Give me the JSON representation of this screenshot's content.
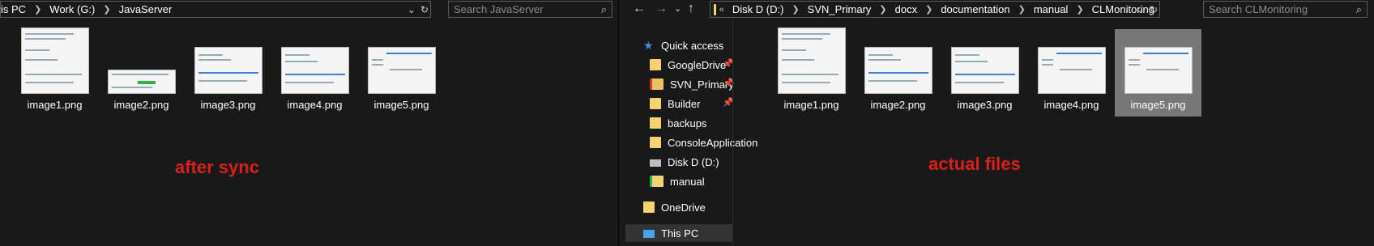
{
  "left": {
    "breadcrumb": [
      "is PC",
      "Work (G:)",
      "JavaServer"
    ],
    "search_placeholder": "Search JavaServer",
    "files": [
      "image1.png",
      "image2.png",
      "image3.png",
      "image4.png",
      "image5.png"
    ],
    "annotation": "after sync",
    "annotation_color": "#d9201a"
  },
  "right": {
    "breadcrumb": [
      "Disk D (D:)",
      "SVN_Primary",
      "docx",
      "documentation",
      "manual",
      "CLMonitoring"
    ],
    "search_placeholder": "Search CLMonitoring",
    "nav": {
      "quick_access": "Quick access",
      "items": [
        "GoogleDrive",
        "SVN_Primary",
        "Builder",
        "backups",
        "ConsoleApplication",
        "Disk D (D:)",
        "manual"
      ],
      "onedrive": "OneDrive",
      "this_pc": "This PC"
    },
    "files": [
      "image1.png",
      "image2.png",
      "image3.png",
      "image4.png",
      "image5.png"
    ],
    "selected_file": "image5.png",
    "annotation": "actual files"
  },
  "icons": {
    "back": "back-arrow-icon",
    "forward": "forward-arrow-icon",
    "recent": "chevron-down-icon",
    "up": "up-arrow-icon",
    "dropdown": "chevron-down-icon",
    "refresh": "refresh-icon",
    "search": "search-icon"
  }
}
